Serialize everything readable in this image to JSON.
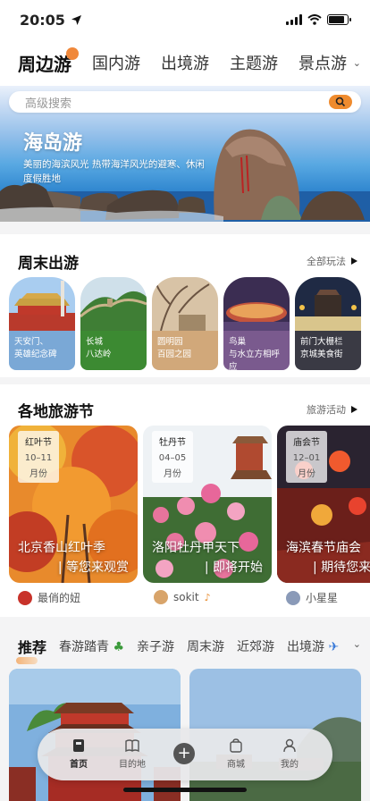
{
  "status": {
    "time": "20:05"
  },
  "top_tabs": [
    "周边游",
    "国内游",
    "出境游",
    "主题游",
    "景点游"
  ],
  "hero": {
    "search_placeholder": "高级搜索",
    "title": "海岛游",
    "subtitle": "美丽的海滨风光 热带海洋风光的避寒、休闲度假胜地"
  },
  "weekend": {
    "title": "周末出游",
    "more": "全部玩法",
    "cards": [
      {
        "line1": "天安门、",
        "line2": "英雄纪念碑",
        "color": "#7aa8d6"
      },
      {
        "line1": "长城",
        "line2": "八达岭",
        "color": "#3c8a32"
      },
      {
        "line1": "圆明园",
        "line2": "百园之园",
        "color": "#d1a87a"
      },
      {
        "line1": "鸟巢",
        "line2": "与水立方相呼应",
        "color": "#7a5a8e"
      },
      {
        "line1": "前门大栅栏",
        "line2": "京城美食街",
        "color": "#3a3a44"
      }
    ]
  },
  "festivals": {
    "title": "各地旅游节",
    "more": "旅游活动",
    "cards": [
      {
        "name": "红叶节",
        "dates": "10–11",
        "unit": "月份",
        "title": "北京香山红叶季",
        "tagline": "| 等您来观赏",
        "author": "最俏的妞"
      },
      {
        "name": "牡丹节",
        "dates": "04–05",
        "unit": "月份",
        "title": "洛阳牡丹甲天下",
        "tagline": "| 即将开始",
        "author": "sokit"
      },
      {
        "name": "庙会节",
        "dates": "12–01",
        "unit": "月份",
        "title": "海滨春节庙会",
        "tagline": "| 期待您来",
        "author": "小星星"
      }
    ]
  },
  "recommend_tabs": [
    "推荐",
    "春游踏青",
    "亲子游",
    "周末游",
    "近郊游",
    "出境游"
  ],
  "bottom_nav": [
    {
      "label": "首页",
      "icon": "home-icon"
    },
    {
      "label": "目的地",
      "icon": "book-icon"
    },
    {
      "label": "商城",
      "icon": "bag-icon"
    },
    {
      "label": "我的",
      "icon": "person-icon"
    }
  ],
  "colors": {
    "accent": "#ef8b2e",
    "background": "#f4f4f5"
  }
}
